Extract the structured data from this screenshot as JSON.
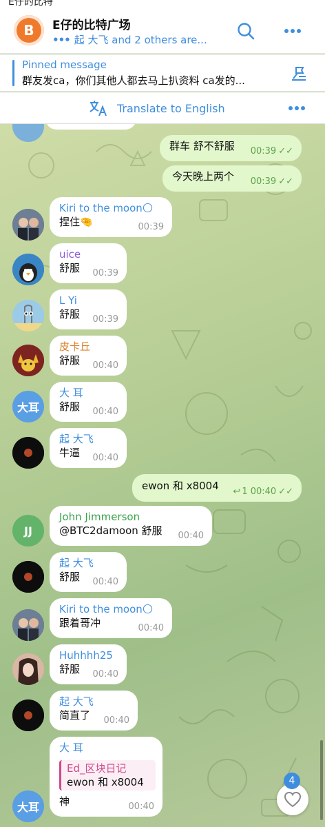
{
  "status_bar": {
    "text": "E仔的比特"
  },
  "header": {
    "avatar_logo": "B",
    "title": "E仔的比特广场",
    "subtitle": "起 大飞 and 2 others are...",
    "typing_indicator": "•••",
    "search_icon": "search-icon",
    "more_icon": "more-icon"
  },
  "pinned": {
    "title": "Pinned message",
    "text": "群友发ca，你们其他人都去马上扒资料  ca发的..."
  },
  "translate": {
    "label": "Translate to English"
  },
  "messages": [
    {
      "type": "out",
      "text": "群车 舒不舒服",
      "time": "00:39"
    },
    {
      "type": "out",
      "text": "今天晚上两个",
      "time": "00:39"
    },
    {
      "type": "in",
      "sender": "Kiri to the moon🌕",
      "text": "捏住🤏",
      "time": "00:39"
    },
    {
      "type": "in",
      "sender": "uice",
      "text": "舒服",
      "time": "00:39"
    },
    {
      "type": "in",
      "sender": "L Yi",
      "text": "舒服",
      "time": "00:39"
    },
    {
      "type": "in",
      "sender": "皮卡丘",
      "text": "舒服",
      "time": "00:40"
    },
    {
      "type": "in",
      "sender": "大 耳",
      "text": "舒服",
      "time": "00:40",
      "avatar_text": "大耳"
    },
    {
      "type": "in",
      "sender": "起 大飞",
      "text": "牛逼",
      "time": "00:40"
    },
    {
      "type": "out",
      "text": "ewon 和 x8004",
      "time": "00:40",
      "replies": "1"
    },
    {
      "type": "in",
      "sender": "John Jimmerson",
      "text": "@BTC2damoon 舒服",
      "time": "00:40",
      "avatar_text": "JJ"
    },
    {
      "type": "in",
      "sender": "起 大飞",
      "text": "舒服",
      "time": "00:40"
    },
    {
      "type": "in",
      "sender": "Kiri to the moon🌕",
      "text": "跟着哥冲",
      "time": "00:40"
    },
    {
      "type": "in",
      "sender": "Huhhhh25",
      "text": "舒服",
      "time": "00:40"
    },
    {
      "type": "in",
      "sender": "起 大飞",
      "text": "简直了",
      "time": "00:40"
    },
    {
      "type": "in",
      "sender": "大 耳",
      "reply_name": "Ed_区块日记",
      "reply_text": "ewon 和 x8004",
      "text": "神",
      "time": "00:40",
      "avatar_text": "大耳"
    }
  ],
  "fab": {
    "badge": "4",
    "icon": "heart-icon"
  },
  "colors": {
    "accent": "#3f8ede",
    "outgoing_bubble": "#e2f7cb",
    "outgoing_meta": "#5fa34d"
  }
}
